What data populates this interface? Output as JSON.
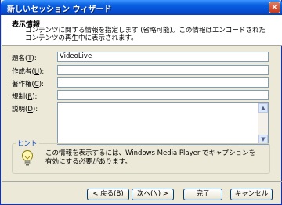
{
  "window": {
    "title": "新しいセッション ウィザード",
    "close_glyph": "×"
  },
  "header": {
    "title": "表示情報",
    "description": "コンテンツに関する情報を指定します (省略可能)。この情報はエンコードされたコンテンツの再生中に表示されます。"
  },
  "form": {
    "fields": [
      {
        "label": "題名(",
        "key": "T",
        "suffix": "):",
        "value": "VideoLive"
      },
      {
        "label": "作成者(",
        "key": "U",
        "suffix": "):",
        "value": ""
      },
      {
        "label": "著作権(",
        "key": "C",
        "suffix": "):",
        "value": ""
      },
      {
        "label": "規制(",
        "key": "R",
        "suffix": "):",
        "value": ""
      },
      {
        "label": "説明(",
        "key": "D",
        "suffix": "):",
        "value": ""
      }
    ]
  },
  "hint": {
    "legend": "ヒント",
    "text": "この情報を表示するには、Windows Media Player でキャプションを有効にする必要があります。",
    "icon": "lightbulb-icon"
  },
  "buttons": {
    "back": "< 戻る(B)",
    "next": "次へ(N) >",
    "finish": "完了",
    "cancel": "キャンセル"
  },
  "colors": {
    "accent": "#0a5fe0",
    "hint_legend": "#0046d5"
  }
}
